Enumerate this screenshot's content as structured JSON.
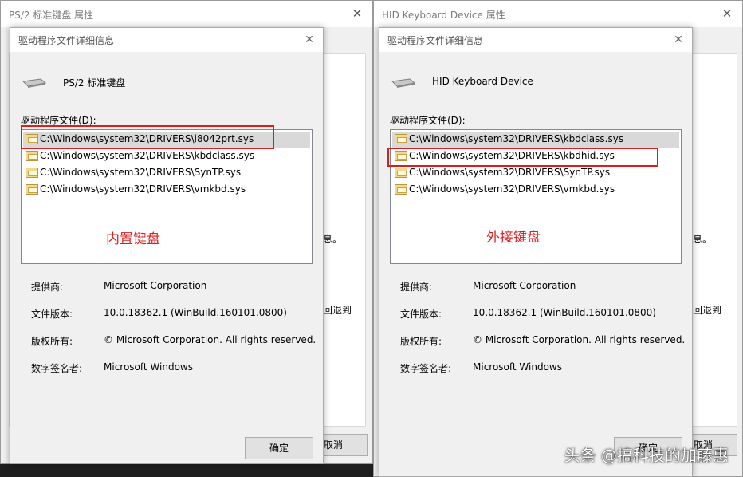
{
  "left": {
    "window_title": "PS/2 标准键盘 属性",
    "peek": {
      "text1": "息。",
      "text2": "回退到",
      "cancel": "取消"
    },
    "dialog": {
      "title": "驱动程序文件详细信息",
      "device_name": "PS/2 标准键盘",
      "list_label": "驱动程序文件(D):",
      "files": [
        "C:\\Windows\\system32\\DRIVERS\\i8042prt.sys",
        "C:\\Windows\\system32\\DRIVERS\\kbdclass.sys",
        "C:\\Windows\\system32\\DRIVERS\\SynTP.sys",
        "C:\\Windows\\system32\\DRIVERS\\vmkbd.sys"
      ],
      "annotation": "内置键盘",
      "props": {
        "provider_label": "提供商:",
        "provider": "Microsoft Corporation",
        "version_label": "文件版本:",
        "version": "10.0.18362.1 (WinBuild.160101.0800)",
        "copyright_label": "版权所有:",
        "copyright": "© Microsoft Corporation. All rights reserved.",
        "signer_label": "数字签名者:",
        "signer": "Microsoft Windows"
      },
      "ok": "确定"
    }
  },
  "right": {
    "window_title": "HID Keyboard Device 属性",
    "peek": {
      "text1": "息。",
      "text2": "回退到",
      "cancel": "取消"
    },
    "dialog": {
      "title": "驱动程序文件详细信息",
      "device_name": "HID Keyboard Device",
      "list_label": "驱动程序文件(D):",
      "files": [
        "C:\\Windows\\system32\\DRIVERS\\kbdclass.sys",
        "C:\\Windows\\system32\\DRIVERS\\kbdhid.sys",
        "C:\\Windows\\system32\\DRIVERS\\SynTP.sys",
        "C:\\Windows\\system32\\DRIVERS\\vmkbd.sys"
      ],
      "annotation": "外接键盘",
      "props": {
        "provider_label": "提供商:",
        "provider": "Microsoft Corporation",
        "version_label": "文件版本:",
        "version": "10.0.18362.1 (WinBuild.160101.0800)",
        "copyright_label": "版权所有:",
        "copyright": "© Microsoft Corporation. All rights reserved.",
        "signer_label": "数字签名者:",
        "signer": "Microsoft Windows"
      },
      "ok": "确定"
    }
  },
  "watermark": "头条 @搞科技的加藤惠",
  "colors": {
    "highlight": "#d61f1f",
    "annotation": "#e02020",
    "selected_row": "#d9d9d9"
  }
}
